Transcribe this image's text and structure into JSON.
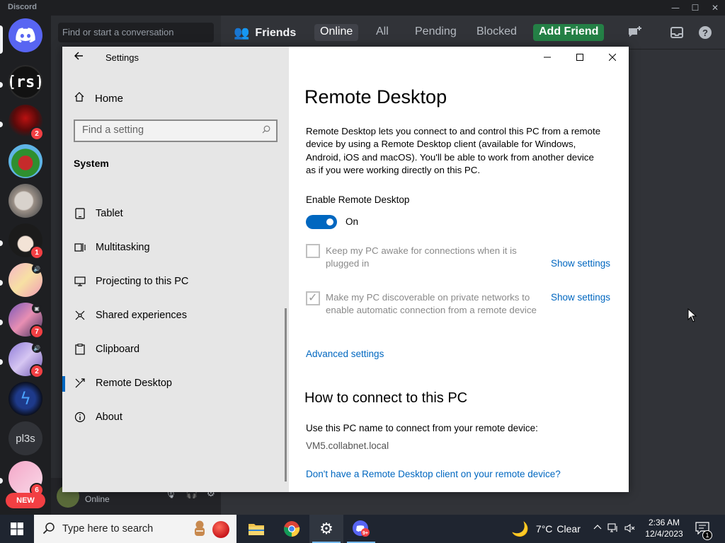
{
  "discord": {
    "app_name": "Discord",
    "search_placeholder": "Find or start a conversation",
    "header": {
      "friends_label": "Friends",
      "tabs": [
        "Online",
        "All",
        "Pending",
        "Blocked"
      ],
      "add_friend": "Add Friend"
    },
    "servers": [
      {
        "name": "[rs]",
        "badge": ""
      },
      {
        "name": "server-red",
        "badge": "2"
      },
      {
        "name": "server-bird",
        "badge": ""
      },
      {
        "name": "server-cat",
        "badge": ""
      },
      {
        "name": "server-anime-1",
        "badge": "1"
      },
      {
        "name": "server-anime-2",
        "badge": ""
      },
      {
        "name": "server-anime-3",
        "badge": "7"
      },
      {
        "name": "server-anime-4",
        "badge": "2"
      },
      {
        "name": "server-blue",
        "badge": ""
      },
      {
        "name": "pl3s",
        "badge": ""
      },
      {
        "name": "server-twos",
        "badge": "6"
      }
    ],
    "new_badge": "NEW",
    "user_status": "Online"
  },
  "settings": {
    "window_title": "Settings",
    "home": "Home",
    "search_placeholder": "Find a setting",
    "section": "System",
    "nav": [
      {
        "label": "Tablet",
        "icon": "tablet-icon"
      },
      {
        "label": "Multitasking",
        "icon": "multitasking-icon"
      },
      {
        "label": "Projecting to this PC",
        "icon": "projecting-icon"
      },
      {
        "label": "Shared experiences",
        "icon": "shared-experiences-icon"
      },
      {
        "label": "Clipboard",
        "icon": "clipboard-icon"
      },
      {
        "label": "Remote Desktop",
        "icon": "remote-desktop-icon",
        "selected": true
      },
      {
        "label": "About",
        "icon": "info-icon"
      }
    ],
    "page_title": "Remote Desktop",
    "description": "Remote Desktop lets you connect to and control this PC from a remote device by using a Remote Desktop client (available for Windows, Android, iOS and macOS). You'll be able to work from another device as if you were working directly on this PC.",
    "enable_label": "Enable Remote Desktop",
    "toggle_state": "On",
    "option_awake": "Keep my PC awake for connections when it is plugged in",
    "option_discoverable": "Make my PC discoverable on private networks to enable automatic connection from a remote device",
    "show_settings": "Show settings",
    "advanced_settings": "Advanced settings",
    "connect_heading": "How to connect to this PC",
    "connect_text": "Use this PC name to connect from your remote device:",
    "pc_name": "VM5.collabnet.local",
    "client_link": "Don't have a Remote Desktop client on your remote device?"
  },
  "taskbar": {
    "search_placeholder": "Type here to search",
    "weather_temp": "7°C",
    "weather_cond": "Clear",
    "time": "2:36 AM",
    "date": "12/4/2023",
    "notification_count": "1"
  }
}
